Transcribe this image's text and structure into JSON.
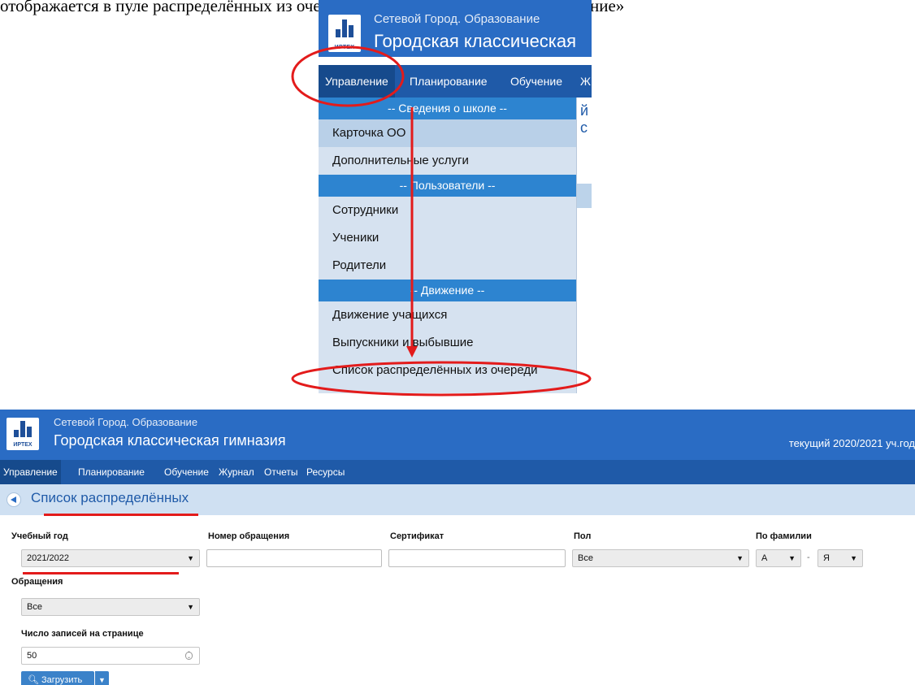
{
  "document": {
    "caption_fragment": "отображается в пуле распределённых из очереди АИС «Сетевой Город. Образование»"
  },
  "menu_screenshot": {
    "logo_text": "ИРТЕХ",
    "subtitle": "Сетевой Город. Образование",
    "title": "Городская классическая",
    "nav": [
      "Управление",
      "Планирование",
      "Обучение",
      "Ж"
    ],
    "background_fragment": "й с",
    "dropdown": {
      "section_school": "-- Сведения о школе --",
      "card": "Карточка ОО",
      "services": "Дополнительные услуги",
      "section_users": "-- Пользователи --",
      "staff": "Сотрудники",
      "students": "Ученики",
      "parents": "Родители",
      "section_movement": "-- Движение --",
      "student_movement": "Движение учащихся",
      "graduates": "Выпускники и выбывшие",
      "distributed_list": "Список распределённых из очереди"
    }
  },
  "list_screenshot": {
    "logo_text": "ИРТЕХ",
    "subtitle": "Сетевой Город. Образование",
    "title": "Городская классическая гимназия",
    "current_year": "текущий 2020/2021 уч.год",
    "nav": [
      "Управление",
      "Планирование",
      "Обучение",
      "Журнал",
      "Отчеты",
      "Ресурсы"
    ],
    "page_title": "Список распределённых",
    "filters": {
      "school_year_label": "Учебный год",
      "school_year_value": "2021/2022",
      "request_number_label": "Номер обращения",
      "certificate_label": "Сертификат",
      "gender_label": "Пол",
      "gender_value": "Все",
      "surname_label": "По фамилии",
      "surname_from": "А",
      "surname_to": "Я",
      "requests_label": "Обращения",
      "requests_value": "Все",
      "per_page_label": "Число записей на странице",
      "per_page_value": "50"
    },
    "load_button": "Загрузить"
  },
  "annotation_color": "#e31b1b"
}
